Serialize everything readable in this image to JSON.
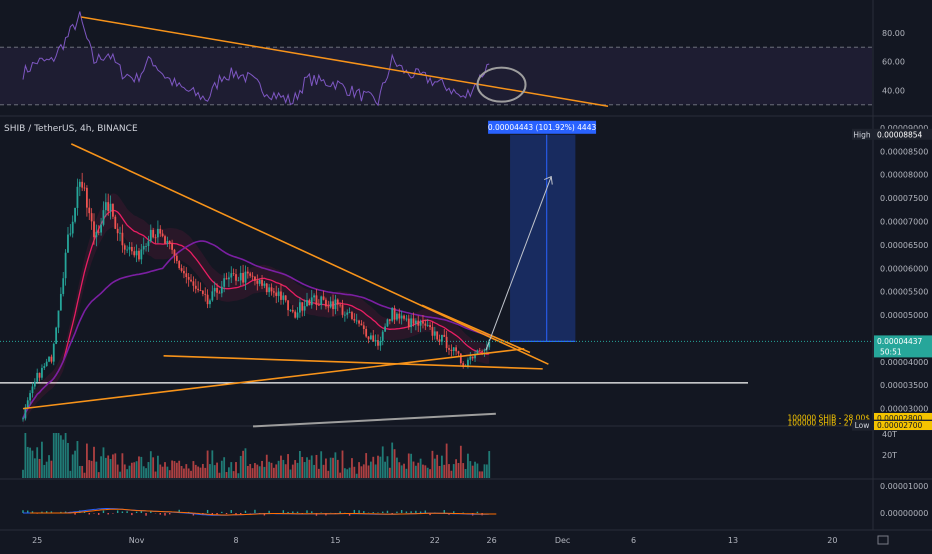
{
  "symbol_legend": "SHIB / TetherUS, 4h, BINANCE",
  "rsi": {
    "ticks": [
      "80.00",
      "60.00",
      "40.00"
    ],
    "tick_values": [
      80,
      60,
      40
    ],
    "range": [
      25,
      100
    ],
    "band": [
      70,
      30
    ]
  },
  "price_axis": {
    "ticks": [
      "0.00009000",
      "0.00008500",
      "0.00008000",
      "0.00007500",
      "0.00007000",
      "0.00006500",
      "0.00006000",
      "0.00005500",
      "0.00005000",
      "0.00004500",
      "0.00004000",
      "0.00003500",
      "0.00003000"
    ],
    "tick_values": [
      9e-05,
      8.5e-05,
      8e-05,
      7.5e-05,
      7e-05,
      6.5e-05,
      6e-05,
      5.5e-05,
      5e-05,
      4.5e-05,
      4e-05,
      3.5e-05,
      3e-05
    ],
    "range": [
      2.65e-05,
      9.17e-05
    ]
  },
  "volume_axis": {
    "ticks": [
      "40T",
      "20T"
    ],
    "tick_values": [
      40,
      20
    ]
  },
  "macd_axis": {
    "ticks": [
      "0.00001000",
      "0.00000000"
    ]
  },
  "x_axis": {
    "labels": [
      "25",
      "Nov",
      "8",
      "15",
      "22",
      "26",
      "Dec",
      "6",
      "13",
      "20"
    ],
    "dates": [
      "2021-10-25",
      "2021-11-01",
      "2021-11-08",
      "2021-11-15",
      "2021-11-22",
      "2021-11-26",
      "2021-12-01",
      "2021-12-06",
      "2021-12-13",
      "2021-12-20"
    ]
  },
  "badges": {
    "high_label": "High",
    "high_value": "0.00008854",
    "current_value": "0.00004437",
    "countdown": "50:51",
    "low_label": "Low",
    "low_value": "0.00002702",
    "level1_value": "0.00002800",
    "level2_value": "0.00002700",
    "level1_note": "100000 SHIB - 28.00$",
    "level2_note": "100000 SHIB - 27.02$",
    "projection": "0.00004443 (101.92%) 4443"
  },
  "colors": {
    "background": "#131722",
    "up": "#26a69a",
    "down": "#ef5350",
    "trendline": "#f7931a",
    "ma_pink": "#e91e63",
    "ma_purple": "#7b1fa2",
    "rsi_line": "#7e57c2",
    "projection": "#2962ff",
    "support": "#ffffff",
    "macd": "#2962ff",
    "signal": "#ff6d00"
  },
  "chart_data": {
    "type": "candlestick",
    "title": "SHIB / TetherUS, 4h, BINANCE",
    "x_start": "2021-10-24",
    "interval": "4h",
    "high": 8.854e-05,
    "low": 2.702e-05,
    "last": 4.437e-05,
    "close_anchors": [
      {
        "date": "2021-10-24",
        "close": 2.85e-05
      },
      {
        "date": "2021-10-25",
        "close": 3.68e-05
      },
      {
        "date": "2021-10-26",
        "close": 4.1e-05
      },
      {
        "date": "2021-10-27",
        "close": 6.3e-05
      },
      {
        "date": "2021-10-28",
        "close": 7.95e-05
      },
      {
        "date": "2021-10-29",
        "close": 6.7e-05
      },
      {
        "date": "2021-10-30",
        "close": 7.35e-05
      },
      {
        "date": "2021-10-31",
        "close": 6.6e-05
      },
      {
        "date": "2021-11-01",
        "close": 6.22e-05
      },
      {
        "date": "2021-11-02",
        "close": 6.85e-05
      },
      {
        "date": "2021-11-03",
        "close": 6.55e-05
      },
      {
        "date": "2021-11-04",
        "close": 6.05e-05
      },
      {
        "date": "2021-11-05",
        "close": 5.58e-05
      },
      {
        "date": "2021-11-06",
        "close": 5.25e-05
      },
      {
        "date": "2021-11-07",
        "close": 5.65e-05
      },
      {
        "date": "2021-11-08",
        "close": 5.82e-05
      },
      {
        "date": "2021-11-09",
        "close": 5.8e-05
      },
      {
        "date": "2021-11-10",
        "close": 5.57e-05
      },
      {
        "date": "2021-11-11",
        "close": 5.48e-05
      },
      {
        "date": "2021-11-12",
        "close": 4.98e-05
      },
      {
        "date": "2021-11-13",
        "close": 5.35e-05
      },
      {
        "date": "2021-11-14",
        "close": 5.28e-05
      },
      {
        "date": "2021-11-15",
        "close": 5.25e-05
      },
      {
        "date": "2021-11-16",
        "close": 4.95e-05
      },
      {
        "date": "2021-11-17",
        "close": 4.68e-05
      },
      {
        "date": "2021-11-18",
        "close": 4.4e-05
      },
      {
        "date": "2021-11-19",
        "close": 5.05e-05
      },
      {
        "date": "2021-11-20",
        "close": 4.85e-05
      },
      {
        "date": "2021-11-21",
        "close": 4.78e-05
      },
      {
        "date": "2021-11-22",
        "close": 4.6e-05
      },
      {
        "date": "2021-11-23",
        "close": 4.35e-05
      },
      {
        "date": "2021-11-24",
        "close": 3.95e-05
      },
      {
        "date": "2021-11-25",
        "close": 4.25e-05
      },
      {
        "date": "2021-11-25T20:00",
        "close": 4.437e-05
      }
    ],
    "support_level": 3.55e-05,
    "projection_target": 8.854e-05,
    "rsi_anchors": [
      {
        "date": "2021-10-24",
        "v": 52
      },
      {
        "date": "2021-10-25",
        "v": 60
      },
      {
        "date": "2021-10-26",
        "v": 60
      },
      {
        "date": "2021-10-27",
        "v": 75
      },
      {
        "date": "2021-10-28",
        "v": 91
      },
      {
        "date": "2021-10-29",
        "v": 60
      },
      {
        "date": "2021-10-30",
        "v": 66
      },
      {
        "date": "2021-10-31",
        "v": 52
      },
      {
        "date": "2021-11-01",
        "v": 48
      },
      {
        "date": "2021-11-02",
        "v": 62
      },
      {
        "date": "2021-11-03",
        "v": 50
      },
      {
        "date": "2021-11-04",
        "v": 42
      },
      {
        "date": "2021-11-05",
        "v": 38
      },
      {
        "date": "2021-11-06",
        "v": 34
      },
      {
        "date": "2021-11-07",
        "v": 50
      },
      {
        "date": "2021-11-08",
        "v": 52
      },
      {
        "date": "2021-11-09",
        "v": 48
      },
      {
        "date": "2021-11-10",
        "v": 40
      },
      {
        "date": "2021-11-11",
        "v": 36
      },
      {
        "date": "2021-11-12",
        "v": 32
      },
      {
        "date": "2021-11-13",
        "v": 48
      },
      {
        "date": "2021-11-14",
        "v": 46
      },
      {
        "date": "2021-11-15",
        "v": 45
      },
      {
        "date": "2021-11-16",
        "v": 40
      },
      {
        "date": "2021-11-17",
        "v": 36
      },
      {
        "date": "2021-11-18",
        "v": 32
      },
      {
        "date": "2021-11-19",
        "v": 61
      },
      {
        "date": "2021-11-20",
        "v": 52
      },
      {
        "date": "2021-11-21",
        "v": 50
      },
      {
        "date": "2021-11-22",
        "v": 46
      },
      {
        "date": "2021-11-23",
        "v": 42
      },
      {
        "date": "2021-11-24",
        "v": 34
      },
      {
        "date": "2021-11-25",
        "v": 46
      },
      {
        "date": "2021-11-25T20:00",
        "v": 59
      }
    ]
  }
}
